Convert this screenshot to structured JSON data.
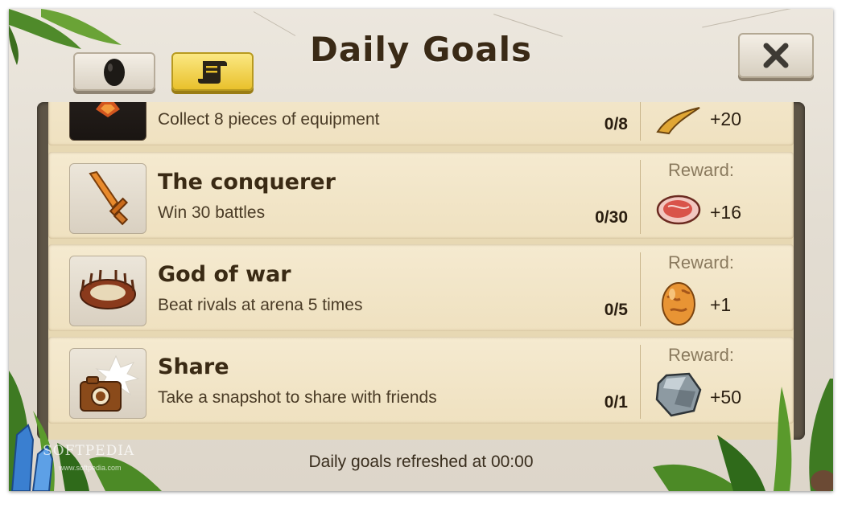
{
  "header": {
    "title": "Daily Goals"
  },
  "tabs": [
    {
      "icon": "egg-icon",
      "active": false
    },
    {
      "icon": "scroll-icon",
      "active": true
    }
  ],
  "close_icon": "close-icon",
  "goals": [
    {
      "title": "",
      "description": "Collect 8 pieces of equipment",
      "progress": "0/8",
      "reward_label": "",
      "reward_icon": "horn-icon",
      "reward_amount": "+20"
    },
    {
      "title": "The conquerer",
      "description": "Win 30 battles",
      "progress": "0/30",
      "reward_label": "Reward:",
      "reward_icon": "meat-icon",
      "reward_amount": "+16"
    },
    {
      "title": "God of war",
      "description": "Beat rivals at arena 5 times",
      "progress": "0/5",
      "reward_label": "Reward:",
      "reward_icon": "egg-icon",
      "reward_amount": "+1"
    },
    {
      "title": "Share",
      "description": "Take a snapshot to share with friends",
      "progress": "0/1",
      "reward_label": "Reward:",
      "reward_icon": "stone-icon",
      "reward_amount": "+50"
    }
  ],
  "footer": {
    "refresh_text": "Daily goals refreshed at 00:00"
  },
  "watermark": {
    "text": "SOFTPEDIA",
    "url": "www.softpedia.com"
  },
  "colors": {
    "active_tab": "#e9c12c",
    "row_bg": "#f2e5c6",
    "panel_frame": "#5d5446",
    "title_text": "#3a2a16"
  }
}
